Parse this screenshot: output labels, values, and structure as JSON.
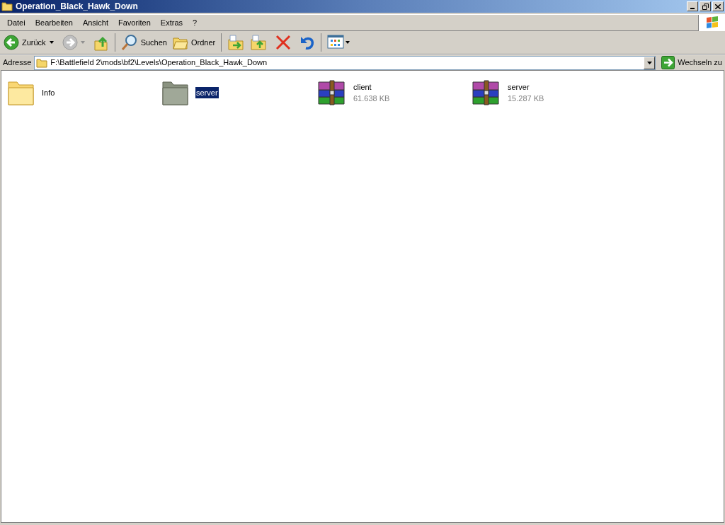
{
  "window": {
    "title": "Operation_Black_Hawk_Down"
  },
  "menu": [
    "Datei",
    "Bearbeiten",
    "Ansicht",
    "Favoriten",
    "Extras",
    "?"
  ],
  "toolbar": {
    "back": "Zurück",
    "search": "Suchen",
    "folders": "Ordner"
  },
  "address": {
    "label": "Adresse",
    "value": "F:\\Battlefield 2\\mods\\bf2\\Levels\\Operation_Black_Hawk_Down",
    "go": "Wechseln zu"
  },
  "items": [
    {
      "kind": "folder",
      "name": "Info",
      "selected": false
    },
    {
      "kind": "folder",
      "name": "server",
      "selected": true
    },
    {
      "kind": "archive",
      "name": "client",
      "size": "61.638 KB",
      "selected": false
    },
    {
      "kind": "archive",
      "name": "server",
      "size": "15.287 KB",
      "selected": false
    }
  ]
}
